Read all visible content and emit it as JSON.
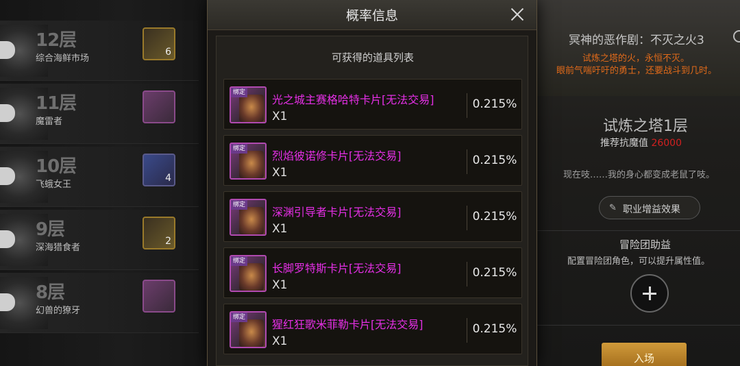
{
  "background_left": {
    "floors": [
      {
        "num": "12层",
        "name": "综合海鲜市场",
        "reward_count": "6",
        "reward_style": "gold"
      },
      {
        "num": "11层",
        "name": "魔雷者",
        "reward_count": "",
        "reward_style": "purple"
      },
      {
        "num": "10层",
        "name": "飞蛾女王",
        "reward_count": "4",
        "reward_style": "blue"
      },
      {
        "num": "9层",
        "name": "深海猎食者",
        "reward_count": "2",
        "reward_style": "gold"
      },
      {
        "num": "8层",
        "name": "幻兽的獠牙",
        "reward_count": "",
        "reward_style": "purple"
      }
    ]
  },
  "background_right": {
    "title": "冥神的恶作剧：不灭之火3",
    "desc_line1": "试炼之塔的火，永恒不灭。",
    "desc_line2": "眼前气喘吁吁的勇士，还要战斗到几时。",
    "floor_title": "试炼之塔1层",
    "recommend_label": "推荐抗魔值",
    "recommend_value": "26000",
    "quote": "现在吱……我的身心都变成老鼠了吱。",
    "job_bonus_label": "职业增益效果",
    "adventure_title": "冒险团助益",
    "adventure_desc": "配置冒险团角色，可以提升属性值。",
    "enter_label": "入场"
  },
  "modal": {
    "title": "概率信息",
    "subtitle": "可获得的道具列表",
    "bind_tag": "绑定",
    "items": [
      {
        "name": "光之城主赛格哈特卡片[无法交易]",
        "qty": "X1",
        "pct": "0.215%"
      },
      {
        "name": "烈焰彼诺修卡片[无法交易]",
        "qty": "X1",
        "pct": "0.215%"
      },
      {
        "name": "深渊引导者卡片[无法交易]",
        "qty": "X1",
        "pct": "0.215%"
      },
      {
        "name": "长脚罗特斯卡片[无法交易]",
        "qty": "X1",
        "pct": "0.215%"
      },
      {
        "name": "猩红狂歌米菲勒卡片[无法交易]",
        "qty": "X1",
        "pct": "0.215%"
      }
    ]
  },
  "colors": {
    "item_name": "#e52fe5",
    "warning_text": "#e06a1a",
    "recommend_value": "#d02020",
    "enter_button": "#c08a2a"
  }
}
